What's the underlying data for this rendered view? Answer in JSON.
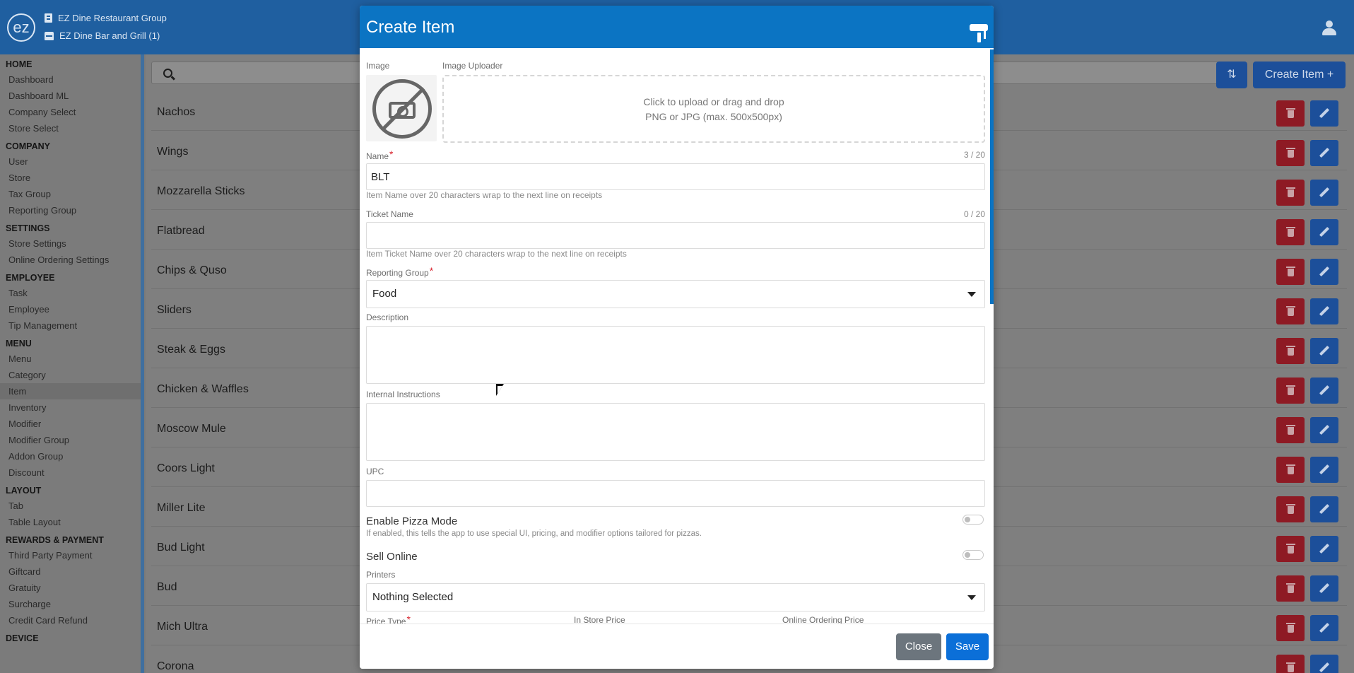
{
  "header": {
    "logo_text": "ez",
    "org_name": "EZ Dine Restaurant Group",
    "store_name": "EZ Dine Bar and Grill (1)"
  },
  "sidebar": {
    "sections": [
      {
        "title": "HOME",
        "items": [
          "Dashboard",
          "Dashboard ML",
          "Company Select",
          "Store Select"
        ]
      },
      {
        "title": "COMPANY",
        "items": [
          "User",
          "Store",
          "Tax Group",
          "Reporting Group"
        ]
      },
      {
        "title": "SETTINGS",
        "items": [
          "Store Settings",
          "Online Ordering Settings"
        ]
      },
      {
        "title": "EMPLOYEE",
        "items": [
          "Task",
          "Employee",
          "Tip Management"
        ]
      },
      {
        "title": "MENU",
        "items": [
          "Menu",
          "Category",
          "Item",
          "Inventory",
          "Modifier",
          "Modifier Group",
          "Addon Group",
          "Discount"
        ]
      },
      {
        "title": "LAYOUT",
        "items": [
          "Tab",
          "Table Layout"
        ]
      },
      {
        "title": "REWARDS & PAYMENT",
        "items": [
          "Third Party Payment",
          "Giftcard",
          "Gratuity",
          "Surcharge",
          "Credit Card Refund"
        ]
      },
      {
        "title": "DEVICE",
        "items": []
      }
    ],
    "active_item": "Item"
  },
  "toolbar": {
    "create_label": "Create Item +",
    "sort_glyph": "⇅"
  },
  "items": [
    "Nachos",
    "Wings",
    "Mozzarella Sticks",
    "Flatbread",
    "Chips & Quso",
    "Sliders",
    "Steak & Eggs",
    "Chicken & Waffles",
    "Moscow Mule",
    "Coors Light",
    "Miller Lite",
    "Bud Light",
    "Bud",
    "Mich Ultra",
    "Corona"
  ],
  "modal": {
    "title": "Create Item",
    "image_label": "Image",
    "uploader_label": "Image Uploader",
    "uploader_line1": "Click to upload or drag and drop",
    "uploader_line2": "PNG or JPG (max. 500x500px)",
    "name_label": "Name",
    "name_counter": "3 / 20",
    "name_value": "BLT",
    "name_hint": "Item Name over 20 characters wrap to the next line on receipts",
    "ticket_label": "Ticket Name",
    "ticket_counter": "0 / 20",
    "ticket_value": "",
    "ticket_hint": "Item Ticket Name over 20 characters wrap to the next line on receipts",
    "reporting_label": "Reporting Group",
    "reporting_value": "Food",
    "description_label": "Description",
    "internal_label": "Internal Instructions",
    "upc_label": "UPC",
    "pizza_title": "Enable Pizza Mode",
    "pizza_hint": "If enabled, this tells the app to use special UI, pricing, and modifier options tailored for pizzas.",
    "pizza_enabled": false,
    "online_title": "Sell Online",
    "online_enabled": false,
    "printers_label": "Printers",
    "printers_value": "Nothing Selected",
    "price_type_label": "Price Type",
    "in_store_label": "In Store Price",
    "online_price_label": "Online Ordering Price",
    "close_label": "Close",
    "save_label": "Save",
    "required_mark": "*"
  },
  "colors": {
    "header_blue": "#0b74c3",
    "save_blue": "#0b6fd8",
    "close_gray": "#6c757d",
    "required_red": "#d9252f"
  }
}
